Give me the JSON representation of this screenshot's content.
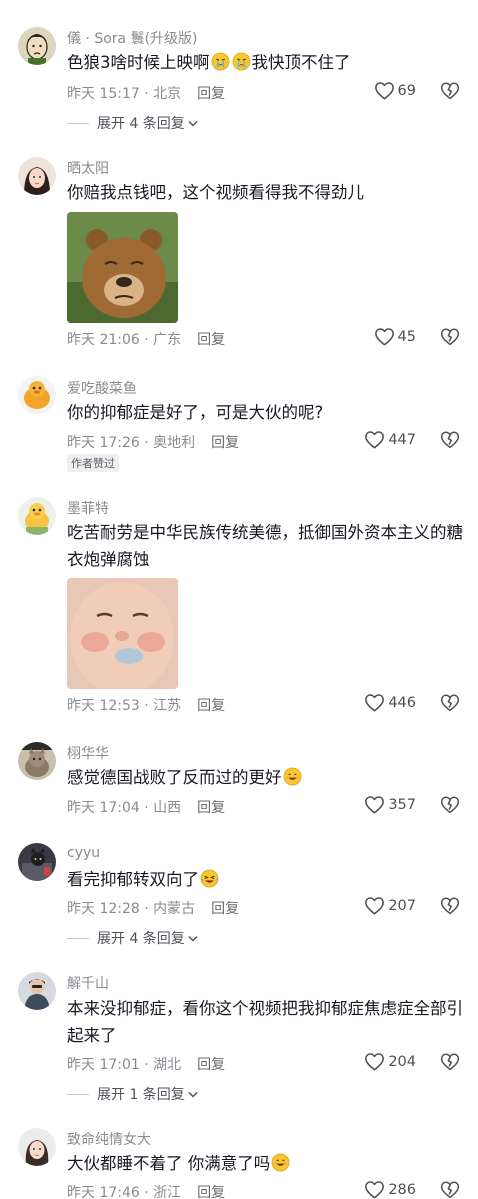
{
  "comments": [
    {
      "username": "儀 · Sora 鬟(升级版)",
      "text_a": "色狼3啥时候上映啊",
      "text_b": "我快顶不住了",
      "emoji": "crying-face-emoji",
      "time": "昨天 15:17 · 北京",
      "reply": "回复",
      "likes": "69",
      "expand": "展开 4 条回复"
    },
    {
      "username": "晒太阳",
      "text": "你赔我点钱吧，这个视频看得我不得劲儿",
      "sticker": "bear-sticker",
      "time": "昨天 21:06 · 广东",
      "reply": "回复",
      "likes": "45"
    },
    {
      "username": "爱吃酸菜鱼",
      "text": "你的抑郁症是好了，可是大伙的呢?",
      "time": "昨天 17:26 · 奥地利",
      "reply": "回复",
      "likes": "447",
      "badge": "作者赞过"
    },
    {
      "username": "墨菲特",
      "text": "吃苦耐劳是中华民族传统美德，抵御国外资本主义的糖衣炮弹腐蚀",
      "sticker": "baby-face-sticker",
      "time": "昨天 12:53 · 江苏",
      "reply": "回复",
      "likes": "446"
    },
    {
      "username": "栩华华",
      "text": "感觉德国战败了反而过的更好",
      "emoji": "smiling-face-emoji",
      "time": "昨天 17:04 · 山西",
      "reply": "回复",
      "likes": "357"
    },
    {
      "username": "cyyu",
      "text": "看完抑郁转双向了",
      "emoji": "laughing-tears-emoji",
      "time": "昨天 12:28 · 内蒙古",
      "reply": "回复",
      "likes": "207",
      "expand": "展开 4 条回复"
    },
    {
      "username": "解千山",
      "text": "本来没抑郁症，看你这个视频把我抑郁症焦虑症全部引起来了",
      "time": "昨天 17:01 · 湖北",
      "reply": "回复",
      "likes": "204",
      "expand": "展开 1 条回复"
    },
    {
      "username": "致命纯情女大",
      "text": "大伙都睡不着了 你满意了吗",
      "emoji": "smiling-face-emoji",
      "time": "昨天 17:46 · 浙江",
      "reply": "回复",
      "likes": "286"
    }
  ]
}
